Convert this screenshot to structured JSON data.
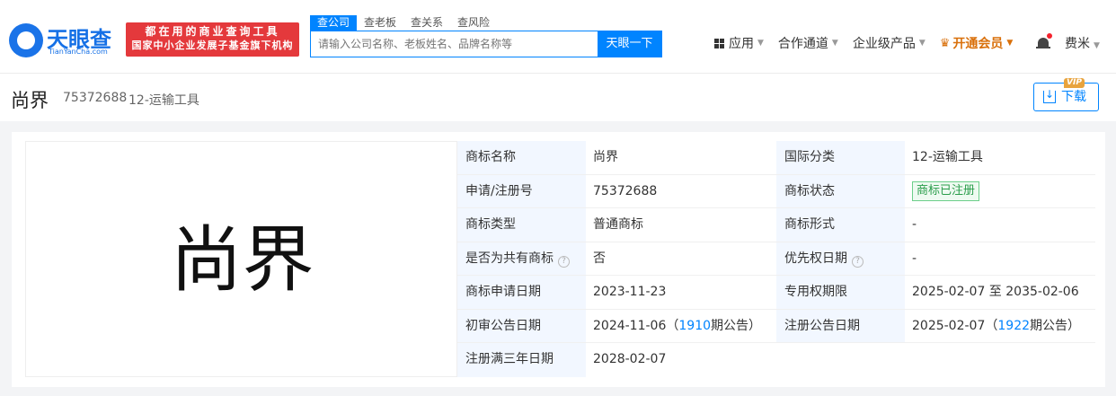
{
  "header": {
    "logo_name": "天眼查",
    "logo_sub": "TianYanCha.com",
    "banner_line1": "都在用的商业查询工具",
    "banner_line2": "国家中小企业发展子基金旗下机构",
    "tabs": [
      {
        "label": "查公司"
      },
      {
        "label": "查老板"
      },
      {
        "label": "查关系"
      },
      {
        "label": "查风险"
      }
    ],
    "search_placeholder": "请输入公司名称、老板姓名、品牌名称等",
    "search_button": "天眼一下",
    "nav": {
      "apps": "应用",
      "channel": "合作通道",
      "enterprise": "企业级产品",
      "vip": "开通会员"
    },
    "user_name": "费米"
  },
  "trademark": {
    "name": "尚界",
    "reg_no": "75372688",
    "class": "12-运输工具",
    "download_label": "下载",
    "vip_tag": "VIP",
    "image_text": "尚界"
  },
  "details": {
    "rows": [
      {
        "k1": "商标名称",
        "v1": "尚界",
        "k2": "国际分类",
        "v2": "12-运输工具"
      },
      {
        "k1": "申请/注册号",
        "v1": "75372688",
        "k2": "商标状态",
        "v2": "商标已注册"
      },
      {
        "k1": "商标类型",
        "v1": "普通商标",
        "k2": "商标形式",
        "v2": "-"
      },
      {
        "k1": "是否为共有商标",
        "v1": "否",
        "k2": "优先权日期",
        "v2": "-"
      },
      {
        "k1": "商标申请日期",
        "v1": "2023-11-23",
        "k2": "专用权期限",
        "v2": "2025-02-07 至 2035-02-06"
      },
      {
        "k1": "初审公告日期",
        "v1_date": "2024-11-06",
        "v1_open": "（",
        "v1_issue": "1910",
        "v1_close": "期公告）",
        "k2": "注册公告日期",
        "v2_date": "2025-02-07",
        "v2_open": "（",
        "v2_issue": "1922",
        "v2_close": "期公告）"
      },
      {
        "k1": "注册满三年日期",
        "v1": "2028-02-07"
      }
    ],
    "help_symbol": "?"
  },
  "colors": {
    "brand": "#0084ff",
    "banner_red": "#e4393c",
    "vip_orange": "#d9700b",
    "status_green": "#2a9d4b"
  }
}
